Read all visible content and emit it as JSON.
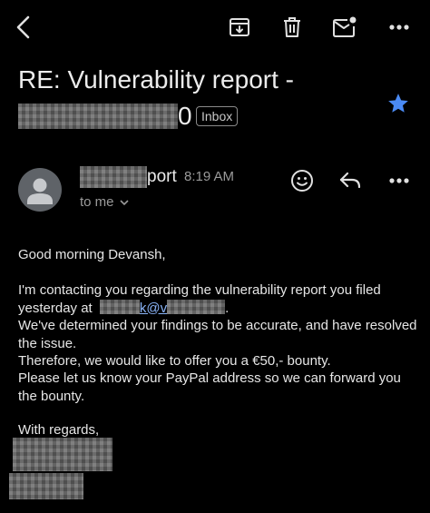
{
  "toolbar": {
    "back_icon": "chevron-left-icon",
    "archive_icon": "archive-icon",
    "delete_icon": "trash-icon",
    "mark_unread_icon": "mail-unread-icon",
    "more_icon": "more-horizontal-icon"
  },
  "message": {
    "subject_line1": "RE: Vulnerability report -",
    "subject_line2_tail": "0",
    "label": "Inbox",
    "starred": true,
    "star_color": "#4a8af4",
    "sender_name_tail": "port",
    "time": "8:19 AM",
    "to_label": "to me",
    "actions": {
      "emoji_icon": "emoji-smile-icon",
      "reply_icon": "reply-icon",
      "more_icon": "more-horizontal-icon"
    },
    "body": {
      "greeting": "Good morning Devansh,",
      "p1_before_link": "I'm contacting you regarding the vulnerability report you filed yesterday at",
      "link_visible_fragment": "k@v",
      "p1_after_link": ".",
      "p2": "We've determined your findings to be accurate, and have resolved the issue.",
      "p3": "Therefore, we would like to offer you a €50,- bounty.",
      "p4": "Please let us know your PayPal address so we can forward you the bounty.",
      "closing": "With regards,"
    }
  }
}
